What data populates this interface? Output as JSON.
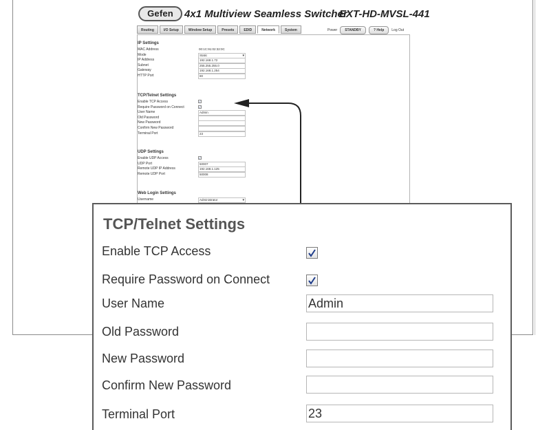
{
  "header": {
    "logo": "Gefen",
    "product_title": "4x1 Multiview Seamless Switcher",
    "model": "EXT-HD-MVSL-441"
  },
  "tabs": [
    {
      "label": "Routing",
      "active": false
    },
    {
      "label": "I/O Setup",
      "active": false
    },
    {
      "label": "Window Setup",
      "active": false
    },
    {
      "label": "Presets",
      "active": false
    },
    {
      "label": "EDID",
      "active": false
    },
    {
      "label": "Network",
      "active": true
    },
    {
      "label": "System",
      "active": false
    }
  ],
  "topbar": {
    "power_label": "Power",
    "standby_label": "STANDBY",
    "help_label": "? Help",
    "logout_label": "Log Out"
  },
  "small_view": {
    "ip_settings": {
      "heading": "IP Settings",
      "rows": [
        {
          "label": "MAC Address",
          "value": "00:1C:91:02:32:0C",
          "kind": "text"
        },
        {
          "label": "Mode",
          "value": "Static",
          "kind": "select"
        },
        {
          "label": "IP Address",
          "value": "192.168.1.72",
          "kind": "field"
        },
        {
          "label": "Subnet",
          "value": "255.255.255.0",
          "kind": "field"
        },
        {
          "label": "Gateway",
          "value": "192.168.1.254",
          "kind": "field"
        },
        {
          "label": "HTTP Port",
          "value": "80",
          "kind": "field"
        }
      ]
    },
    "tcp_settings": {
      "heading": "TCP/Telnet Settings",
      "rows": [
        {
          "label": "Enable TCP Access",
          "value": "",
          "kind": "check"
        },
        {
          "label": "Require Password on Connect",
          "value": "",
          "kind": "check"
        },
        {
          "label": "User Name",
          "value": "Admin",
          "kind": "field"
        },
        {
          "label": "Old Password",
          "value": "",
          "kind": "field"
        },
        {
          "label": "New Password",
          "value": "",
          "kind": "field"
        },
        {
          "label": "Confirm New Password",
          "value": "",
          "kind": "field"
        },
        {
          "label": "Terminal Port",
          "value": "23",
          "kind": "field"
        }
      ]
    },
    "udp_settings": {
      "heading": "UDP Settings",
      "rows": [
        {
          "label": "Enable UDP Access",
          "value": "",
          "kind": "check"
        },
        {
          "label": "UDP Port",
          "value": "50007",
          "kind": "field"
        },
        {
          "label": "Remote UDP IP Address",
          "value": "192.168.1.125",
          "kind": "field"
        },
        {
          "label": "Remote UDP Port",
          "value": "50008",
          "kind": "field"
        }
      ]
    },
    "web_login": {
      "heading": "Web Login Settings",
      "rows": [
        {
          "label": "Username",
          "value": "Administrator",
          "kind": "select"
        }
      ]
    }
  },
  "callout": {
    "title": "TCP/Telnet Settings",
    "enable_tcp_label": "Enable TCP Access",
    "enable_tcp_checked": true,
    "require_password_label": "Require Password on Connect",
    "require_password_checked": true,
    "user_name_label": "User Name",
    "user_name_value": "Admin",
    "old_password_label": "Old Password",
    "old_password_value": "",
    "new_password_label": "New Password",
    "new_password_value": "",
    "confirm_password_label": "Confirm New Password",
    "confirm_password_value": "",
    "terminal_port_label": "Terminal Port",
    "terminal_port_value": "23"
  },
  "colors": {
    "checkmark": "#1f3d8a",
    "callout_border": "#5a5a5a",
    "arrow": "#222222"
  }
}
